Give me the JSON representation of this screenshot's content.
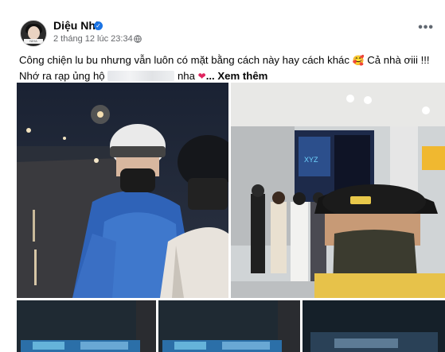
{
  "post": {
    "author": "Diệu Nhi",
    "timestamp": "2 tháng 12 lúc 23:34 ·",
    "verified_icon": "verified-badge-icon",
    "privacy_icon": "globe-icon",
    "more_icon": "more-options-icon",
    "avatar_label": "NIHA",
    "caption_part1": "Công chiện lu bu nhưng vẫn luôn có mặt bằng cách này hay cách khác",
    "caption_emoji1": "🥰",
    "caption_part2": "Cả nhà ơiii !!! Nhớ ra rạp ủng hộ",
    "caption_part3": "nha",
    "caption_see_more": "... Xem thêm"
  },
  "photos": [
    {
      "label": "photo-motorbike-selfie"
    },
    {
      "label": "photo-cinema-lobby-selfie"
    },
    {
      "label": "photo-screen-1"
    },
    {
      "label": "photo-screen-2"
    },
    {
      "label": "photo-screen-3"
    }
  ],
  "colors": {
    "link_blue": "#1b74e4",
    "text": "#050505",
    "secondary_text": "#65676b"
  }
}
